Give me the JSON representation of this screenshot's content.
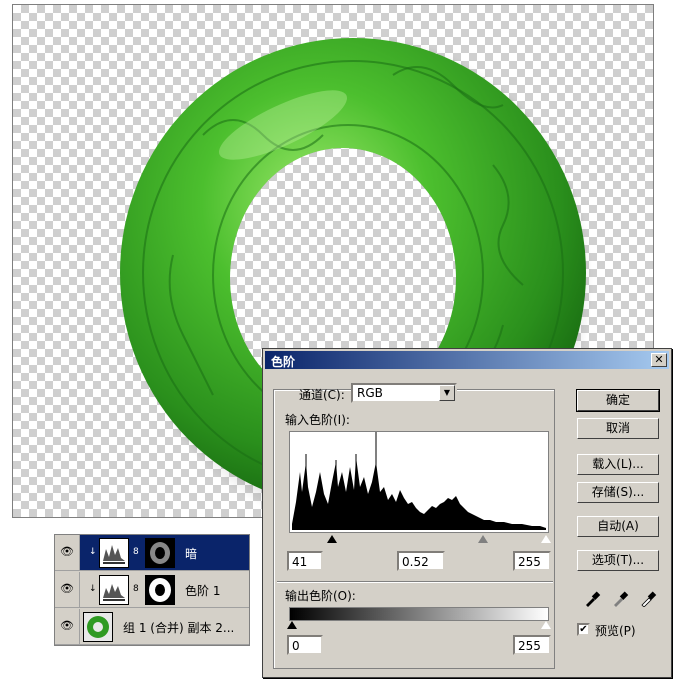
{
  "layers": {
    "items": [
      {
        "name": "暗",
        "selected": true
      },
      {
        "name": "色阶 1",
        "selected": false
      },
      {
        "name": "组 1 (合并) 副本 2...",
        "selected": false
      }
    ]
  },
  "dialog": {
    "title": "色阶",
    "close_label": "✕",
    "channel_label": "通道(C):",
    "channel_value": "RGB",
    "input_levels_label": "输入色阶(I):",
    "input_black": "41",
    "input_gamma": "0.52",
    "input_white": "255",
    "output_levels_label": "输出色阶(O):",
    "output_black": "0",
    "output_white": "255",
    "buttons": {
      "ok": "确定",
      "cancel": "取消",
      "load": "载入(L)...",
      "save": "存储(S)...",
      "auto": "自动(A)",
      "options": "选项(T)..."
    },
    "preview_label": "预览(P)",
    "preview_checked": true
  },
  "colors": {
    "jade_dark": "#1f7d1a",
    "jade_light": "#6fd24a",
    "selection": "#0a246a"
  },
  "icons": [
    "eye-icon",
    "eyedropper-black-icon",
    "eyedropper-gray-icon",
    "eyedropper-white-icon",
    "link-icon",
    "close-icon",
    "dropdown-arrow-icon"
  ]
}
